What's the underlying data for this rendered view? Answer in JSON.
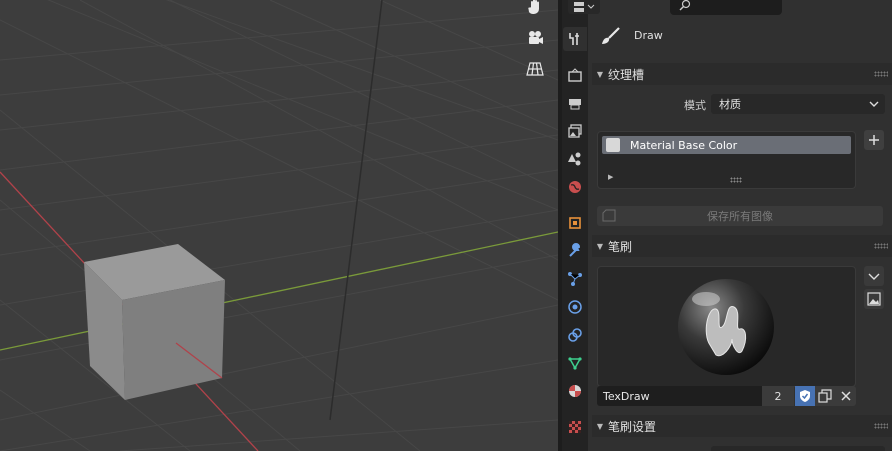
{
  "tool_header": {
    "tool_name": "Draw"
  },
  "panels": {
    "texture_slots": {
      "title": "纹理槽",
      "mode_label": "模式",
      "mode_value": "材质",
      "slots": [
        "Material Base Color"
      ],
      "save_all_label": "保存所有图像"
    },
    "brush": {
      "title": "笔刷",
      "brush_name": "TexDraw",
      "user_count": "2"
    },
    "brush_settings": {
      "title": "笔刷设置"
    }
  },
  "icons": {
    "viewport_tools": [
      "hand-icon",
      "camera-icon",
      "grid-icon"
    ],
    "property_tabs": [
      "tool-icon",
      "render-icon",
      "output-icon",
      "view-layer-icon",
      "scene-icon",
      "world-icon",
      "object-icon",
      "modifier-icon",
      "particles-icon",
      "physics-icon",
      "constraints-icon",
      "data-icon",
      "material-icon",
      "texture-icon"
    ]
  },
  "colors": {
    "accent_blue": "#4772b3",
    "x_axis": "#b0424a",
    "y_axis": "#7a9a3a"
  }
}
